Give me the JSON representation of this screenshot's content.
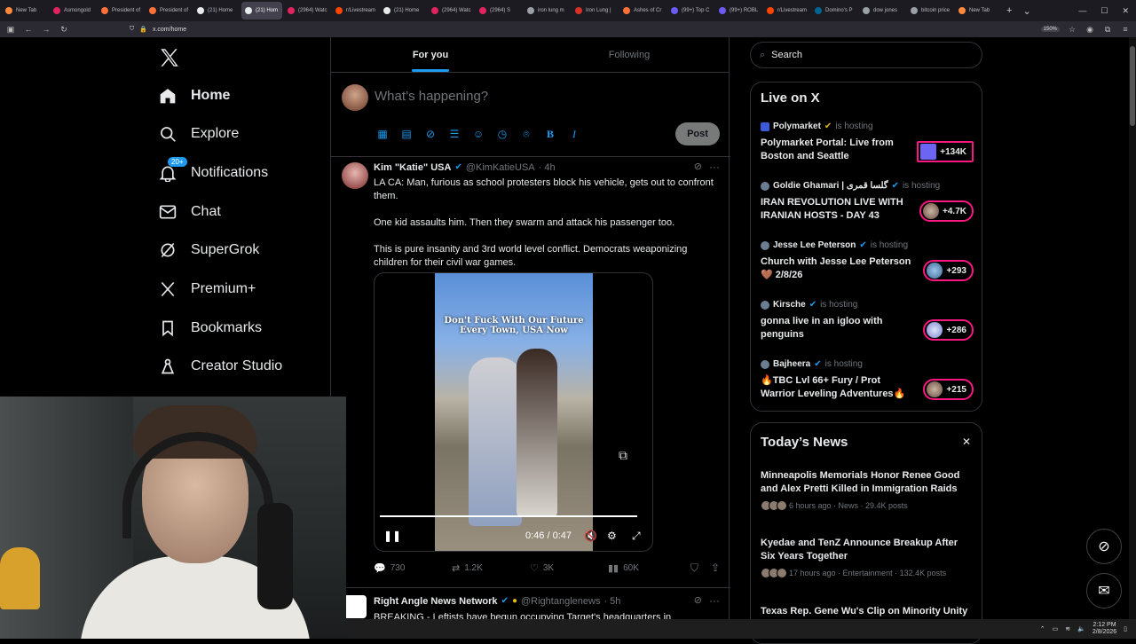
{
  "browser": {
    "tabs": [
      {
        "label": "New Tab",
        "active": false
      },
      {
        "label": "Asmongold",
        "active": false
      },
      {
        "label": "President of",
        "active": false
      },
      {
        "label": "President of",
        "active": false
      },
      {
        "label": "(21) Home",
        "active": false
      },
      {
        "label": "(21) Hom",
        "active": true
      },
      {
        "label": "(2964) Watc",
        "active": false
      },
      {
        "label": "r/Livestream",
        "active": false
      },
      {
        "label": "(21) Home",
        "active": false
      },
      {
        "label": "(2964) Watc",
        "active": false
      },
      {
        "label": "(2964) S",
        "active": false
      },
      {
        "label": "iron lung m",
        "active": false
      },
      {
        "label": "Iron Lung |",
        "active": false
      },
      {
        "label": "Ashes of Cr",
        "active": false
      },
      {
        "label": "(99+) Top C",
        "active": false
      },
      {
        "label": "(99+) ROBL",
        "active": false
      },
      {
        "label": "r/Livestream",
        "active": false
      },
      {
        "label": "Domino's P",
        "active": false
      },
      {
        "label": "dow jones",
        "active": false
      },
      {
        "label": "bitcoin price",
        "active": false
      },
      {
        "label": "New Tab",
        "active": false
      }
    ],
    "url": "x.com/home",
    "zoom": "150%"
  },
  "nav": {
    "items": [
      {
        "label": "Home",
        "icon": "home-icon"
      },
      {
        "label": "Explore",
        "icon": "search-icon"
      },
      {
        "label": "Notifications",
        "icon": "bell-icon"
      },
      {
        "label": "Chat",
        "icon": "mail-icon"
      },
      {
        "label": "SuperGrok",
        "icon": "grok-icon"
      },
      {
        "label": "Premium+",
        "icon": "x-icon"
      },
      {
        "label": "Bookmarks",
        "icon": "bookmark-icon"
      },
      {
        "label": "Creator Studio",
        "icon": "creator-icon"
      }
    ],
    "notifications_badge": "20+"
  },
  "feed": {
    "tabs": [
      "For you",
      "Following"
    ],
    "compose_placeholder": "What’s happening?",
    "post_label": "Post"
  },
  "tweet1": {
    "name": "Kim \"Katie\" USA",
    "handle": "@KimKatieUSA",
    "time": "· 4h",
    "paragraphs": [
      "LA CA: Man, furious as school protesters block his vehicle, gets out to confront them.",
      "One kid assaults him. Then they swarm and attack his passenger too.",
      "This is pure insanity and 3rd world level conflict.  Democrats weaponizing children for their civil war games."
    ],
    "video_caption": "Don't Fuck With Our Future Every Town, USA Now",
    "video_time": "0:46 / 0:47",
    "video_progress": 0.98,
    "replies": "730",
    "reposts": "1.2K",
    "likes": "3K",
    "views": "60K"
  },
  "tweet2": {
    "name": "Right Angle News Network",
    "handle": "@Rightanglenews",
    "time": "· 5h",
    "preview": "BREAKING - Leftists have begun occupying Target's headquarters in"
  },
  "right": {
    "search_placeholder": "Search",
    "live_title": "Live on X",
    "live": [
      {
        "host": "Polymarket",
        "suffix": "is hosting",
        "title": "Polymarket Portal: Live from Boston and Seattle",
        "count": "+134K"
      },
      {
        "host": "Goldie Ghamari | گلسا قمری",
        "suffix": "is hosting",
        "title": "IRAN REVOLUTION LIVE WITH IRANIAN HOSTS - DAY 43",
        "count": "+4.7K"
      },
      {
        "host": "Jesse Lee Peterson",
        "suffix": "is hosting",
        "title": "Church with Jesse Lee Peterson 🤎 2/8/26",
        "count": "+293"
      },
      {
        "host": "Kirsche",
        "suffix": "is hosting",
        "title": "gonna live in an igloo with penguins",
        "count": "+286"
      },
      {
        "host": "Bajheera",
        "suffix": "is hosting",
        "title": "🔥TBC Lvl 66+ Fury / Prot Warrior Leveling Adventures🔥",
        "count": "+215"
      }
    ],
    "news_title": "Today’s News",
    "news": [
      {
        "title": "Minneapolis Memorials Honor Renee Good and Alex Pretti Killed in Immigration Raids",
        "meta": "6 hours ago · News · 29.4K posts"
      },
      {
        "title": "Kyedae and TenZ Announce Breakup After Six Years Together",
        "meta": "17 hours ago · Entertainment · 132.4K posts"
      },
      {
        "title": "Texas Rep. Gene Wu's Clip on Minority Unity",
        "meta": ""
      }
    ]
  },
  "taskbar": {
    "time": "2:12 PM",
    "date": "2/8/2026"
  }
}
